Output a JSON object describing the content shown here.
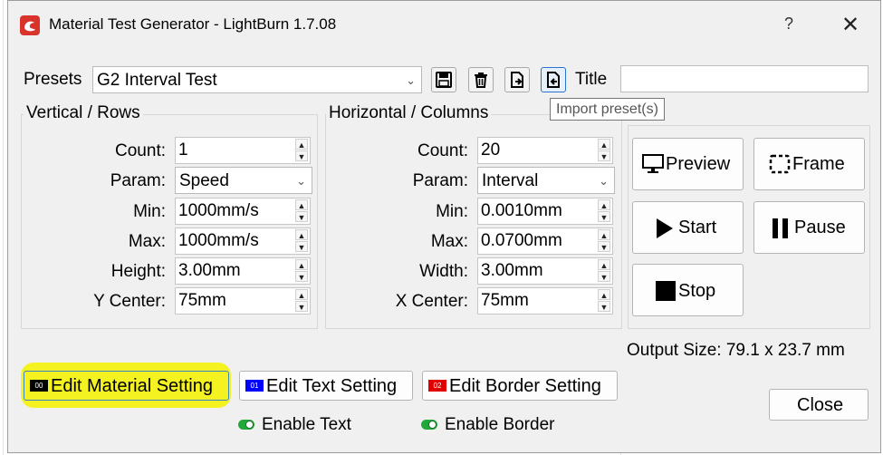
{
  "window": {
    "title": "Material Test Generator - LightBurn 1.7.08",
    "help_glyph": "?",
    "close_glyph": "✕"
  },
  "presets": {
    "label": "Presets",
    "selected": "G2 Interval Test",
    "title_label": "Title",
    "title_value": "",
    "tooltip": "Import preset(s)"
  },
  "vertical": {
    "group_title": "Vertical / Rows",
    "count_label": "Count:",
    "count_value": "1",
    "param_label": "Param:",
    "param_value": "Speed",
    "min_label": "Min:",
    "min_value": "1000mm/s",
    "max_label": "Max:",
    "max_value": "1000mm/s",
    "height_label": "Height:",
    "height_value": "3.00mm",
    "center_label": "Y Center:",
    "center_value": "75mm"
  },
  "horizontal": {
    "group_title": "Horizontal / Columns",
    "count_label": "Count:",
    "count_value": "20",
    "param_label": "Param:",
    "param_value": "Interval",
    "min_label": "Min:",
    "min_value": "0.0010mm",
    "max_label": "Max:",
    "max_value": "0.0700mm",
    "width_label": "Width:",
    "width_value": "3.00mm",
    "center_label": "X Center:",
    "center_value": "75mm"
  },
  "actions": {
    "preview": "Preview",
    "frame": "Frame",
    "start": "Start",
    "pause": "Pause",
    "stop": "Stop"
  },
  "output_size": "Output Size: 79.1 x 23.7 mm",
  "settings": {
    "material": {
      "chip": "00",
      "label": "Edit Material Setting",
      "chip_color": "#000000"
    },
    "text": {
      "chip": "01",
      "label": "Edit Text Setting",
      "chip_color": "#0000ff"
    },
    "border": {
      "chip": "02",
      "label": "Edit Border Setting",
      "chip_color": "#e00000"
    }
  },
  "toggles": {
    "enable_text": "Enable Text",
    "enable_border": "Enable Border"
  },
  "close_label": "Close",
  "colors": {
    "highlight": "#f4f20a",
    "toggle_on": "#21a83b",
    "app_icon": "#d9342b"
  }
}
